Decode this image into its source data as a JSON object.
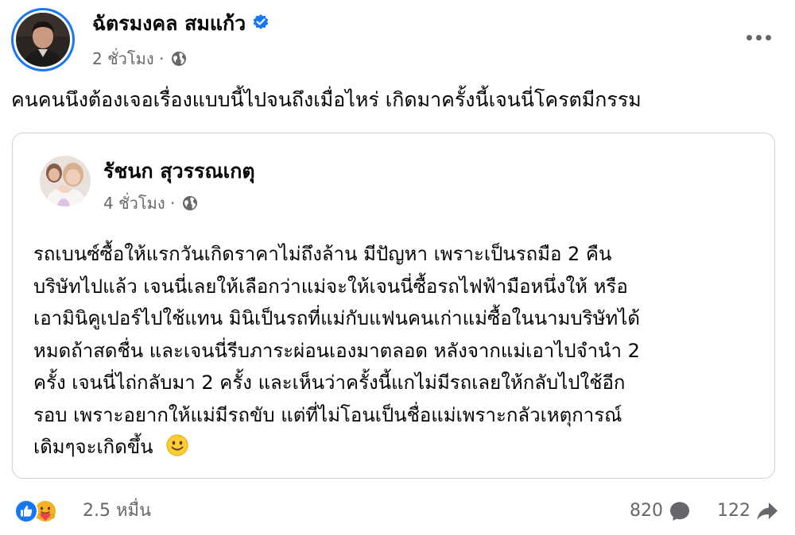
{
  "post": {
    "author_name": "ฉัตรมงคล สมแก้ว",
    "timestamp": "2 ชั่วโมง",
    "separator": "·",
    "audience_icon": "globe-icon",
    "text": "คนคนนึงต้องเจอเรื่องแบบนี้ไปจนถึงเมื่อไหร่ เกิดมาครั้งนี้เจนนี่โครตมีกรรม"
  },
  "shared": {
    "author_name": "รัชนก สุวรรณเกตุ",
    "timestamp": "4 ชั่วโมง",
    "separator": "·",
    "audience_icon": "globe-icon",
    "lines": [
      "รถเบนซ์ซื้อให้แรกวันเกิดราคาไม่ถึงล้าน มีปัญหา เพราะเป็นรถมือ 2 คืน",
      "บริษัทไปแล้ว เจนนี่เลยให้เลือกว่าแม่จะให้เจนนี่ซื้อรถไฟฟ้ามือหนึ่งให้ หรือ",
      "เอามินิคูเปอร์ไปใช้แทน มินิเป็นรถที่แม่กับแฟนคนเก่าแม่ซื้อในนามบริษัทได้",
      "หมดถ้าสดชื่น และเจนนี่รีบภาระผ่อนเองมาตลอด  หลังจากแม่เอาไปจำนำ 2",
      "ครั้ง เจนนี่ไถ่กลับมา 2 ครั้ง และเห็นว่าครั้งนี้แกไม่มีรถเลยให้กลับไปใช้อีก",
      "รอบ เพราะอยากให้แม่มีรถขับ แต่ที่ไม่โอนเป็นชื่อแม่เพราะกลัวเหตุการณ์",
      "เดิมๆจะเกิดขึ้น"
    ],
    "end_emoji": "smiling-face-emoji"
  },
  "footer": {
    "reaction_icons": [
      "like-reaction-icon",
      "care-reaction-icon"
    ],
    "reaction_count": "2.5 หมื่น",
    "comment_count": "820",
    "comment_icon": "comment-icon",
    "share_count": "122",
    "share_icon": "share-icon"
  },
  "colors": {
    "accent": "#1877f2",
    "secondary_text": "#65676b",
    "card_border": "#ced0d4",
    "care_yellow": "#f7b125"
  }
}
